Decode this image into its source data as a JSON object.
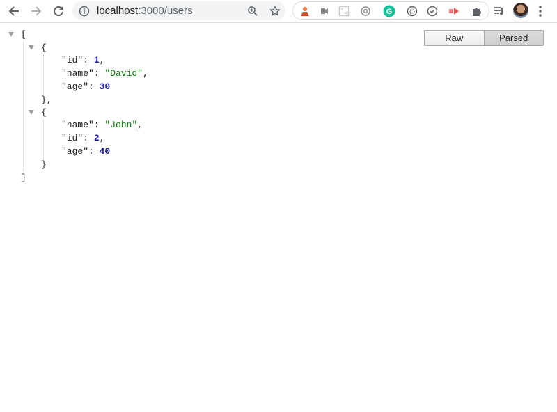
{
  "browser": {
    "url_host": "localhost",
    "url_path": ":3000/users",
    "icons": {
      "back": "back-arrow-icon",
      "forward": "forward-arrow-icon",
      "reload": "reload-icon",
      "info": "info-icon",
      "zoom": "zoom-in-icon",
      "bookmark": "star-icon",
      "extensions": "puzzle-icon",
      "media": "media-control-icon",
      "menu": "kebab-menu-icon"
    },
    "colors": {
      "grammarly": "#15c39a",
      "json_string": "#0b7d0b",
      "json_number": "#1a1aa6"
    }
  },
  "viewer": {
    "raw_label": "Raw",
    "parsed_label": "Parsed",
    "selected": "Parsed"
  },
  "json": {
    "open_array": "[",
    "close_array": "]",
    "items": [
      {
        "open": "{",
        "close": "},",
        "fields": [
          {
            "key": "\"id\"",
            "value": "1",
            "type": "number",
            "sep": ","
          },
          {
            "key": "\"name\"",
            "value": "\"David\"",
            "type": "string",
            "sep": ","
          },
          {
            "key": "\"age\"",
            "value": "30",
            "type": "number",
            "sep": ""
          }
        ]
      },
      {
        "open": "{",
        "close": "}",
        "fields": [
          {
            "key": "\"name\"",
            "value": "\"John\"",
            "type": "string",
            "sep": ","
          },
          {
            "key": "\"id\"",
            "value": "2",
            "type": "number",
            "sep": ","
          },
          {
            "key": "\"age\"",
            "value": "40",
            "type": "number",
            "sep": ""
          }
        ]
      }
    ]
  }
}
